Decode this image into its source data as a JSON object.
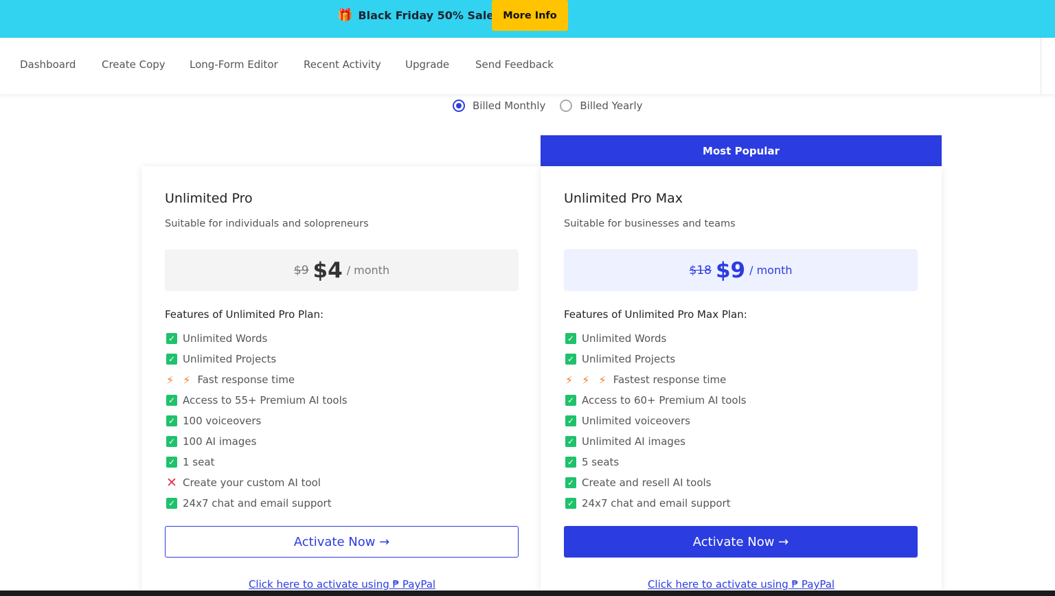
{
  "banner": {
    "gift_icon": "gift-icon",
    "text": "Black Friday 50% Sale",
    "button": "More Info",
    "bg_color": "#32d3f0",
    "button_color": "#ffc300"
  },
  "nav": {
    "items": [
      "Dashboard",
      "Create Copy",
      "Long-Form Editor",
      "Recent Activity",
      "Upgrade",
      "Send Feedback"
    ]
  },
  "billing": {
    "monthly": "Billed Monthly",
    "yearly": "Billed Yearly",
    "selected": "monthly"
  },
  "popular_label": "Most Popular",
  "accent_color": "#2b3ce0",
  "plans": [
    {
      "name": "Unlimited Pro",
      "desc": "Suitable for individuals and solopreneurs",
      "old_price": "$9",
      "price": "$4",
      "period": "/ month",
      "features_title": "Features of Unlimited Pro Plan:",
      "features": [
        {
          "icon": "check",
          "text": "Unlimited Words"
        },
        {
          "icon": "check",
          "text": "Unlimited Projects"
        },
        {
          "icon": "bolt2",
          "text": "Fast response time"
        },
        {
          "icon": "check",
          "text": "Access to 55+ Premium AI tools"
        },
        {
          "icon": "check",
          "text": "100 voiceovers"
        },
        {
          "icon": "check",
          "text": "100 AI images"
        },
        {
          "icon": "check",
          "text": "1 seat"
        },
        {
          "icon": "cross",
          "text": "Create your custom AI tool"
        },
        {
          "icon": "check",
          "text": "24x7 chat and email support"
        }
      ],
      "cta": "Activate Now →",
      "paypal": "Click here to activate using ₱ PayPal"
    },
    {
      "name": "Unlimited Pro Max",
      "desc": "Suitable for businesses and teams",
      "old_price": "$18",
      "price": "$9",
      "period": "/ month",
      "features_title": "Features of Unlimited Pro Max Plan:",
      "features": [
        {
          "icon": "check",
          "text": "Unlimited Words"
        },
        {
          "icon": "check",
          "text": "Unlimited Projects"
        },
        {
          "icon": "bolt3",
          "text": "Fastest response time"
        },
        {
          "icon": "check",
          "text": "Access to 60+ Premium AI tools"
        },
        {
          "icon": "check",
          "text": "Unlimited voiceovers"
        },
        {
          "icon": "check",
          "text": "Unlimited AI images"
        },
        {
          "icon": "check",
          "text": "5 seats"
        },
        {
          "icon": "check",
          "text": "Create and resell AI tools"
        },
        {
          "icon": "check",
          "text": "24x7 chat and email support"
        }
      ],
      "cta": "Activate Now →",
      "paypal": "Click here to activate using ₱ PayPal"
    }
  ]
}
